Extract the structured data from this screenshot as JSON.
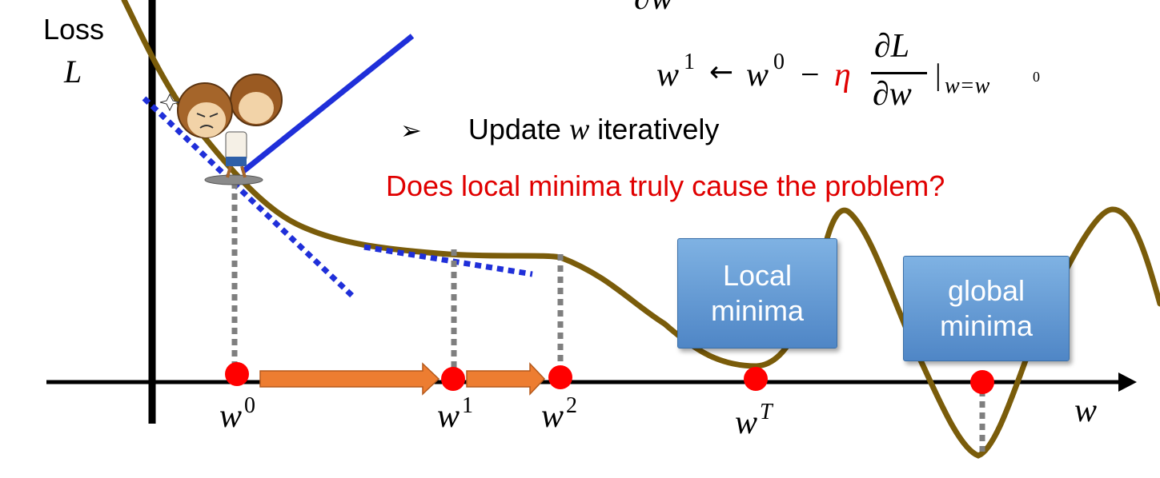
{
  "axis": {
    "y_label_line1": "Loss",
    "y_label_line2": "L",
    "x_label": "w"
  },
  "equations": {
    "partial_top": "∂w",
    "update_lhs": "w",
    "update_lhs_sup": "1",
    "arrow": "←",
    "update_w0": "w",
    "update_w0_sup": "0",
    "minus": "−",
    "eta": "η",
    "frac_num": "∂L",
    "frac_den": "∂w",
    "eval_bar": "|",
    "eval_sub": "w=w",
    "eval_sub_sup": "0"
  },
  "bullet": {
    "marker": "➢",
    "text_before": "Update ",
    "var": "w",
    "text_after": " iteratively"
  },
  "question": "Does local minima truly cause the problem?",
  "points": [
    {
      "base": "w",
      "sup": "0"
    },
    {
      "base": "w",
      "sup": "1"
    },
    {
      "base": "w",
      "sup": "2"
    },
    {
      "base": "w",
      "sup": "T"
    }
  ],
  "boxes": {
    "local_line1": "Local",
    "local_line2": "minima",
    "global_line1": "global",
    "global_line2": "minima"
  },
  "colors": {
    "curve": "#7a5c0a",
    "tangent": "#1f2fd9",
    "point": "#ff0000",
    "arrow": "#ed7d31",
    "eta": "#e00000",
    "question": "#e00000",
    "guide": "#7f7f7f"
  }
}
